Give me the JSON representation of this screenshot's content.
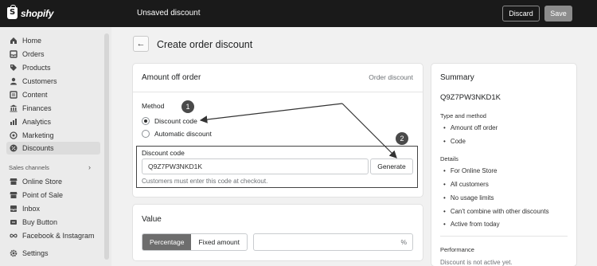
{
  "topbar": {
    "brand": "shopify",
    "title": "Unsaved discount",
    "discard_label": "Discard",
    "save_label": "Save"
  },
  "sidebar": {
    "items": [
      {
        "label": "Home",
        "icon": "home-icon"
      },
      {
        "label": "Orders",
        "icon": "orders-icon"
      },
      {
        "label": "Products",
        "icon": "tag-icon"
      },
      {
        "label": "Customers",
        "icon": "person-icon"
      },
      {
        "label": "Content",
        "icon": "content-icon"
      },
      {
        "label": "Finances",
        "icon": "bank-icon"
      },
      {
        "label": "Analytics",
        "icon": "chart-icon"
      },
      {
        "label": "Marketing",
        "icon": "target-icon"
      },
      {
        "label": "Discounts",
        "icon": "discount-icon"
      }
    ],
    "sales_channels_label": "Sales channels",
    "channels": [
      {
        "label": "Online Store",
        "icon": "store-icon"
      },
      {
        "label": "Point of Sale",
        "icon": "pos-icon"
      },
      {
        "label": "Inbox",
        "icon": "inbox-icon"
      },
      {
        "label": "Buy Button",
        "icon": "buy-button-icon"
      },
      {
        "label": "Facebook & Instagram",
        "icon": "infinity-icon"
      }
    ],
    "settings_label": "Settings"
  },
  "page": {
    "back_icon": "arrow-left-icon",
    "title": "Create order discount"
  },
  "discount_card": {
    "title": "Amount off order",
    "subtitle": "Order discount",
    "method_label": "Method",
    "options": [
      "Discount code",
      "Automatic discount"
    ],
    "selected_option": "Discount code",
    "code_label": "Discount code",
    "code_value": "Q9Z7PW3NKD1K",
    "generate_label": "Generate",
    "help_text": "Customers must enter this code at checkout."
  },
  "annotations": {
    "badge1": "1",
    "badge2": "2"
  },
  "value_card": {
    "title": "Value",
    "segments": [
      "Percentage",
      "Fixed amount"
    ],
    "selected_segment": "Percentage",
    "value": "",
    "suffix": "%"
  },
  "summary": {
    "title": "Summary",
    "code": "Q9Z7PW3NKD1K",
    "type_heading": "Type and method",
    "type_items": [
      "Amount off order",
      "Code"
    ],
    "details_heading": "Details",
    "details_items": [
      "For Online Store",
      "All customers",
      "No usage limits",
      "Can't combine with other discounts",
      "Active from today"
    ],
    "performance_heading": "Performance",
    "performance_text": "Discount is not active yet."
  }
}
